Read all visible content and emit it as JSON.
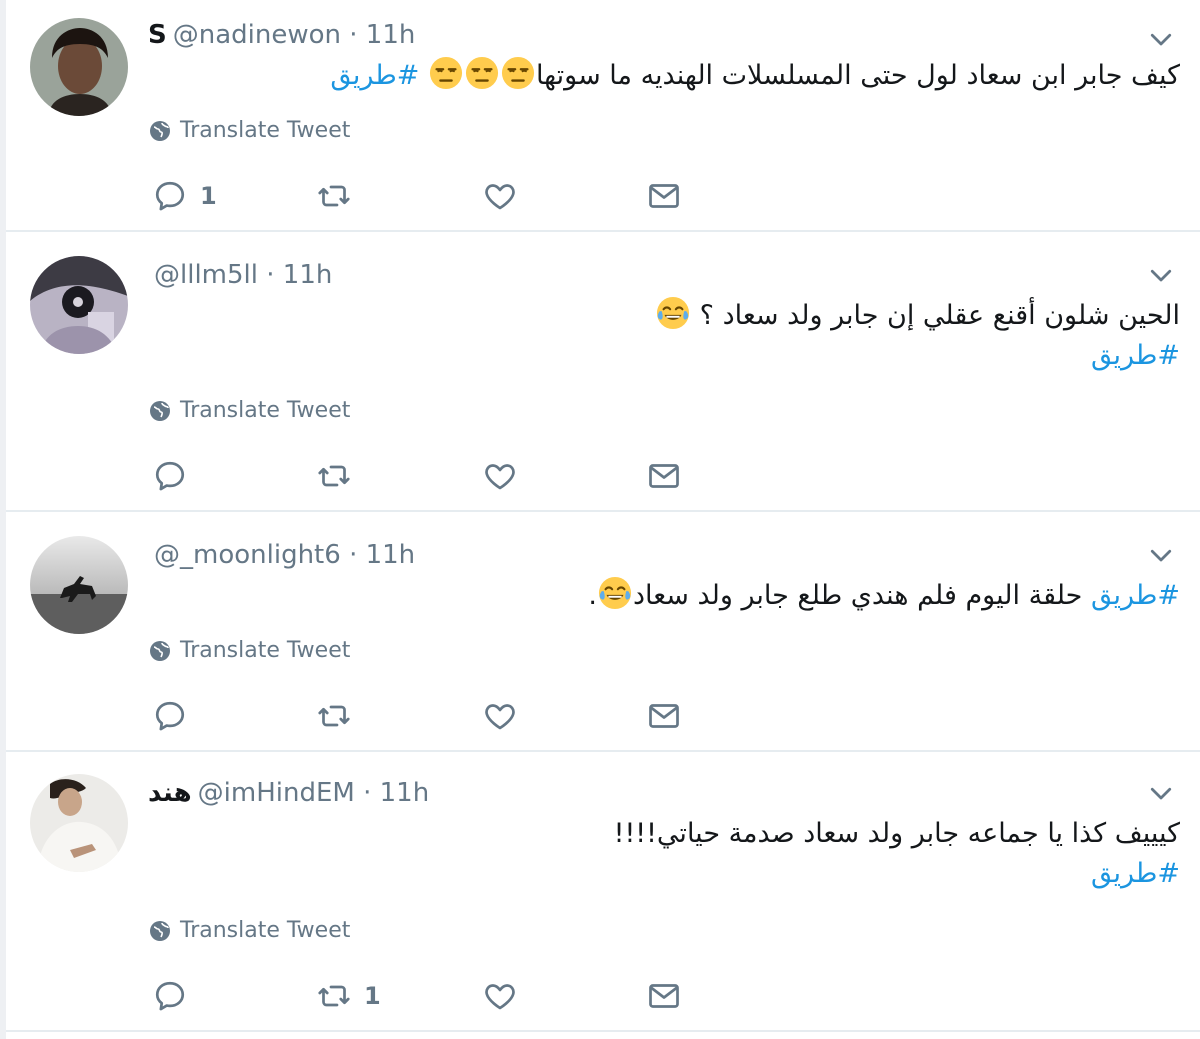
{
  "tweets": [
    {
      "name": "S",
      "handle": "@nadinewon",
      "time": "· 11h",
      "lines": [
        {
          "text": "كيف جابر ابن سعاد لول حتى المسلسلات الهنديه ما سوتها",
          "emoji_count": 3,
          "emoji": "unamused-face-emoji",
          "hashtag": "#طريق"
        }
      ],
      "translate_label": "Translate Tweet",
      "actions": {
        "reply_count": "1",
        "retweet_count": "",
        "like_count": ""
      }
    },
    {
      "name": "",
      "handle": "@lllm5ll",
      "time": "· 11h",
      "lines": [
        {
          "text": "الحين شلون أقنع عقلي إن جابر ولد سعاد ؟",
          "emoji_count": 1,
          "emoji": "tears-of-joy-emoji",
          "hashtag": ""
        },
        {
          "text": "",
          "emoji_count": 0,
          "emoji": "",
          "hashtag": "#طريق"
        }
      ],
      "translate_label": "Translate Tweet",
      "actions": {
        "reply_count": "",
        "retweet_count": "",
        "like_count": ""
      }
    },
    {
      "name": "",
      "handle": "@_moonlight6",
      "time": "· 11h",
      "lines": [
        {
          "hashtag_first": "#طريق",
          "text": "حلقة اليوم فلم هندي طلع جابر ولد سعاد",
          "emoji_count": 1,
          "emoji": "tears-of-joy-emoji",
          "suffix": "."
        }
      ],
      "translate_label": "Translate Tweet",
      "actions": {
        "reply_count": "",
        "retweet_count": "",
        "like_count": ""
      }
    },
    {
      "name": "هند",
      "handle": "@imHindEM",
      "time": "· 11h",
      "lines": [
        {
          "text": "كيييف كذا يا جماعه جابر ولد سعاد صدمة حياتي!!!!",
          "emoji_count": 0,
          "emoji": "",
          "hashtag": ""
        },
        {
          "text": "",
          "emoji_count": 0,
          "emoji": "",
          "hashtag": "#طريق"
        }
      ],
      "translate_label": "Translate Tweet",
      "actions": {
        "reply_count": "",
        "retweet_count": "1",
        "like_count": ""
      }
    }
  ],
  "colors": {
    "link": "#1b95e0",
    "muted": "#657786",
    "divider": "#e6ecf0",
    "text": "#14171a"
  },
  "icons": [
    "chevron-down-icon",
    "globe-icon",
    "reply-icon",
    "retweet-icon",
    "like-icon",
    "message-icon"
  ]
}
